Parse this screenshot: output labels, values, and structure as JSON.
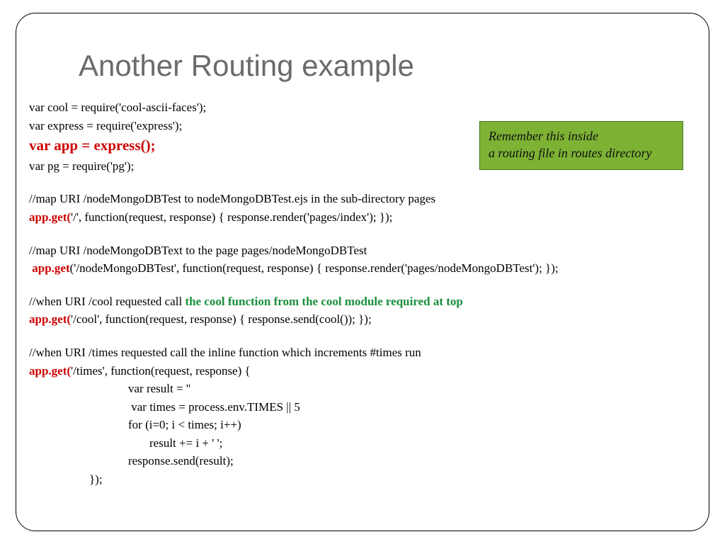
{
  "title": "Another Routing example",
  "callout": {
    "line1": "Remember this inside",
    "line2": "a routing file in routes directory"
  },
  "code": {
    "l1": "var cool = require('cool-ascii-faces');",
    "l2": "var express = require('express');",
    "l3": "var app = express();",
    "l4": "var pg = require('pg');",
    "l5": "//map URI /nodeMongoDBTest to nodeMongoDBTest.ejs in the sub-directory pages",
    "l6a": "app.get(",
    "l6b": "'/', function(request, response) { response.render('pages/index'); });",
    "l7": "//map URI /nodeMongoDBText to the page pages/nodeMongoDBTest",
    "l8a": " app.get",
    "l8b": "('/nodeMongoDBTest', function(request, response) { response.render('pages/nodeMongoDBTest'); });",
    "l9a": "//when URI /cool requested call ",
    "l9b": "the cool function from the cool module required at top",
    "l10a": "app.get(",
    "l10b": "'/cool', function(request, response) { response.send(cool()); });",
    "l11": "//when URI /times requested call the inline function which increments #times run",
    "l12a": "app.get(",
    "l12b": "'/times', function(request, response) {",
    "l13": "var result = ''",
    "l14": " var times = process.env.TIMES || 5",
    "l15": "for (i=0; i < times; i++)",
    "l16": "result += i + ' ';",
    "l17": "response.send(result);",
    "l18": "});"
  }
}
